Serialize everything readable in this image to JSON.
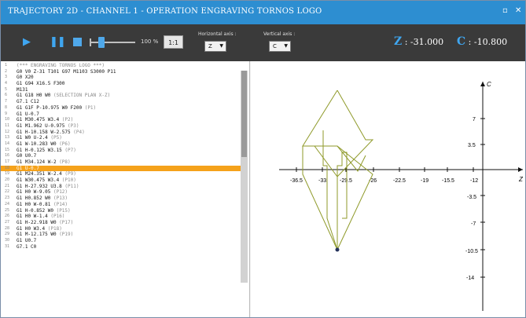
{
  "window": {
    "title": "TRAJECTORY 2D  -  CHANNEL 1  -  OPERATION ENGRAVING TORNOS LOGO",
    "controls": [
      "▫",
      "✕"
    ]
  },
  "toolbar": {
    "play_icon": "play-icon",
    "pause_icon": "pause-icon",
    "stop_icon": "stop-icon",
    "speed_percent": "100 %",
    "speed_box": "1:1",
    "horizontal_axis": {
      "label": "Horizontal axis :",
      "value": "Z"
    },
    "vertical_axis": {
      "label": "Vertical axis :",
      "value": "C"
    },
    "z_readout": {
      "axis": "Z",
      "value": ": -31.000"
    },
    "c_readout": {
      "axis": "C",
      "value": ": -10.800"
    }
  },
  "colors": {
    "accent": "#2d8ed1",
    "active_line": "#f5a21b",
    "path": "#8f9a2a"
  },
  "program": {
    "active_index": 17,
    "lines": [
      {
        "n": "1",
        "code": "(*** ENGRAVING TORNOS LOGO ***)",
        "comment": true
      },
      {
        "n": "2",
        "code": "G0 V0 Z-31 T101 G97 M1103 S3000 P11",
        "comment": false
      },
      {
        "n": "3",
        "code": "G0 X20",
        "comment": false
      },
      {
        "n": "4",
        "code": "G1 G94 X16.5 F300",
        "comment": false
      },
      {
        "n": "5",
        "code": "M131",
        "comment": false
      },
      {
        "n": "6",
        "code": "G1 G18 H0 W0 ",
        "comment": false,
        "note": "(SELECTION PLAN X-Z)"
      },
      {
        "n": "7",
        "code": "G7.1 C12",
        "comment": false
      },
      {
        "n": "8",
        "code": "G1 G1F P-10.975 W0 F200 ",
        "comment": false,
        "note": "(P1)"
      },
      {
        "n": "9",
        "code": "G1 U-0.7",
        "comment": false
      },
      {
        "n": "10",
        "code": "G1 M30.475 W3.4 ",
        "comment": false,
        "note": "(P2)"
      },
      {
        "n": "11",
        "code": "G1 M1.962 U-0.975 ",
        "comment": false,
        "note": "(P3)"
      },
      {
        "n": "12",
        "code": "G1 H-10.158 W-2.575 ",
        "comment": false,
        "note": "(P4)"
      },
      {
        "n": "13",
        "code": "G1 W0 U-2.4 ",
        "comment": false,
        "note": "(P5)"
      },
      {
        "n": "14",
        "code": "G1 W-10.283 W0 ",
        "comment": false,
        "note": "(P6)"
      },
      {
        "n": "15",
        "code": "G1 H-0.125 W3.15 ",
        "comment": false,
        "note": "(P7)"
      },
      {
        "n": "16",
        "code": "G0 U0.7",
        "comment": false
      },
      {
        "n": "17",
        "code": "G1 M34.124 W-2 ",
        "comment": false,
        "note": "(P8)"
      },
      {
        "n": "18",
        "code": "G1 U-0.7",
        "comment": false
      },
      {
        "n": "19",
        "code": "G1 M24.351 W-2.4 ",
        "comment": false,
        "note": "(P9)"
      },
      {
        "n": "20",
        "code": "G1 W30.475 W3.4 ",
        "comment": false,
        "note": "(P10)"
      },
      {
        "n": "21",
        "code": "G1 H-27.932 U3.8 ",
        "comment": false,
        "note": "(P11)"
      },
      {
        "n": "22",
        "code": "G1 H0 W-9.05 ",
        "comment": false,
        "note": "(P12)"
      },
      {
        "n": "23",
        "code": "G1 H0.852 W0 ",
        "comment": false,
        "note": "(P13)"
      },
      {
        "n": "24",
        "code": "G1 H0 W-0.81 ",
        "comment": false,
        "note": "(P14)"
      },
      {
        "n": "25",
        "code": "G1 H-0.852 W0 ",
        "comment": false,
        "note": "(P15)"
      },
      {
        "n": "26",
        "code": "G1 H0 W-1.4 ",
        "comment": false,
        "note": "(P16)"
      },
      {
        "n": "27",
        "code": "G1 H-22.918 W0 ",
        "comment": false,
        "note": "(P17)"
      },
      {
        "n": "28",
        "code": "G1 H0 W3.4 ",
        "comment": false,
        "note": "(P18)"
      },
      {
        "n": "29",
        "code": "G1 M-12.175 W0 ",
        "comment": false,
        "note": "(P19)"
      },
      {
        "n": "30",
        "code": "G1 U0.7",
        "comment": false
      },
      {
        "n": "31",
        "code": "G7.1 C0",
        "comment": false
      }
    ]
  },
  "plot": {
    "x_axis": {
      "name": "Z",
      "ticks": [
        "-36.5",
        "-33",
        "-29.5",
        "-26",
        "-22.5",
        "-19",
        "-15.5",
        "-12"
      ]
    },
    "y_axis": {
      "name": "C",
      "ticks": [
        "7",
        "3.5",
        "-3.5",
        "-7",
        "-10.5",
        "-14"
      ]
    },
    "end_marker": "tool-position-dot"
  }
}
